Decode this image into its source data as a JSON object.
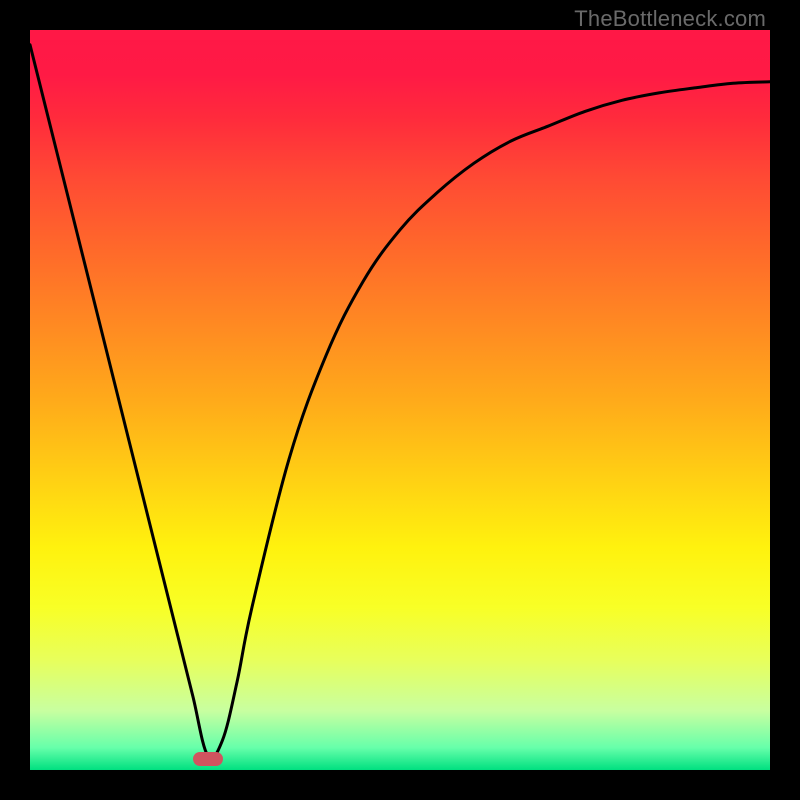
{
  "watermark": "TheBottleneck.com",
  "chart_data": {
    "type": "line",
    "title": "",
    "xlabel": "",
    "ylabel": "",
    "xlim": [
      0,
      100
    ],
    "ylim": [
      0,
      100
    ],
    "grid": false,
    "series": [
      {
        "name": "curve",
        "x": [
          0,
          5,
          10,
          15,
          20,
          22,
          24,
          26,
          28,
          30,
          35,
          40,
          45,
          50,
          55,
          60,
          65,
          70,
          75,
          80,
          85,
          90,
          95,
          100
        ],
        "y": [
          98,
          78,
          58,
          38,
          18,
          10,
          2,
          4,
          12,
          22,
          42,
          56,
          66,
          73,
          78,
          82,
          85,
          87,
          89,
          90.5,
          91.5,
          92.2,
          92.8,
          93
        ]
      }
    ],
    "marker": {
      "x": 24,
      "y": 1.5,
      "color": "#d0545f"
    },
    "background_gradient": {
      "top": "#ff1846",
      "mid": "#fff20e",
      "bottom": "#00e080"
    }
  }
}
